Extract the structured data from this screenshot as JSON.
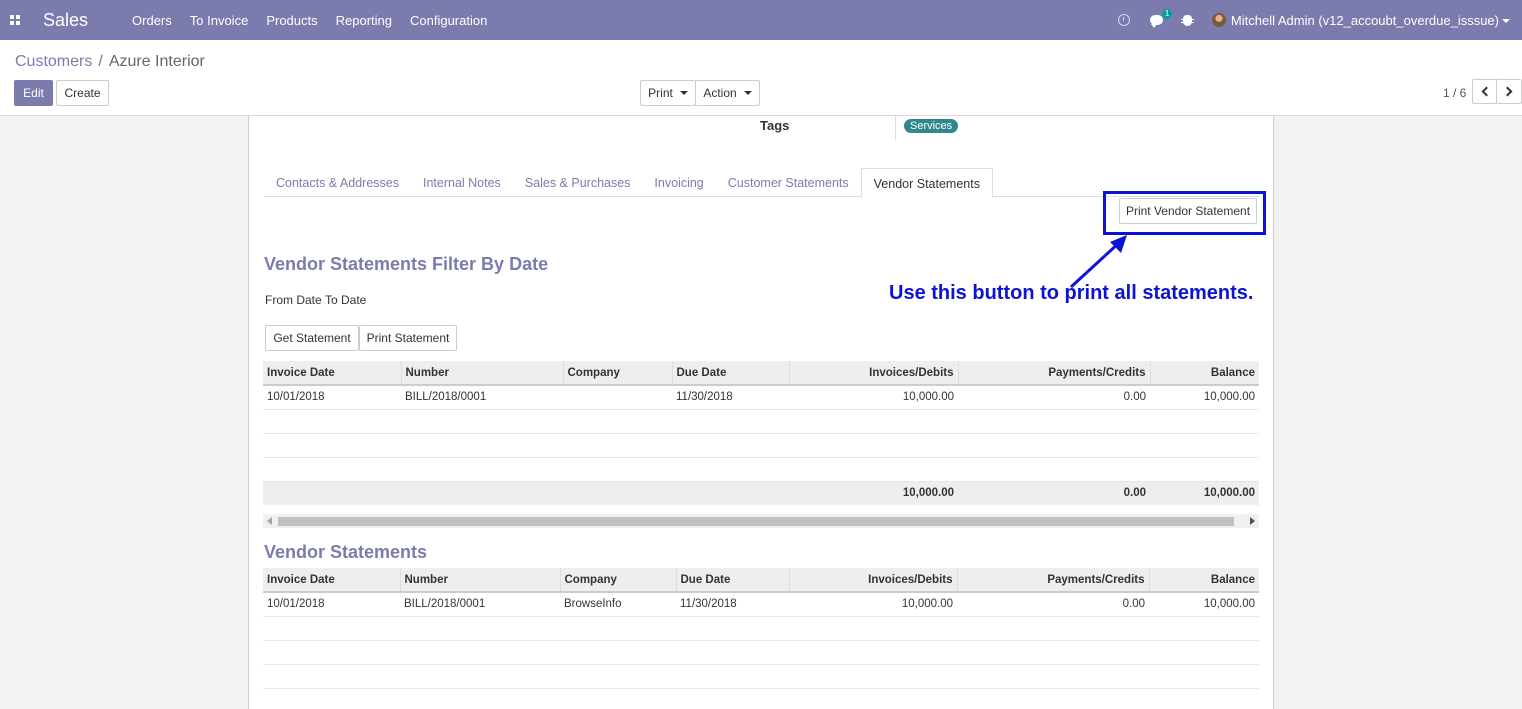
{
  "navbar": {
    "brand": "Sales",
    "menu": [
      "Orders",
      "To Invoice",
      "Products",
      "Reporting",
      "Configuration"
    ],
    "chat_badge": "1",
    "user": "Mitchell Admin (v12_accoubt_overdue_isssue)"
  },
  "breadcrumb": {
    "parent": "Customers",
    "separator": "/",
    "current": "Azure Interior"
  },
  "buttons": {
    "edit": "Edit",
    "create": "Create",
    "print": "Print",
    "action": "Action"
  },
  "pager": {
    "value": "1 / 6"
  },
  "form": {
    "tags_label": "Tags",
    "tag": "Services",
    "tabs": [
      "Contacts & Addresses",
      "Internal Notes",
      "Sales & Purchases",
      "Invoicing",
      "Customer Statements",
      "Vendor Statements"
    ],
    "print_vendor_statement": "Print Vendor Statement",
    "annotation": "Use this button to print all statements.",
    "filter_title": "Vendor Statements Filter By Date",
    "from_date": "From Date",
    "to_date": "To Date",
    "get_statement": "Get Statement",
    "print_statement": "Print Statement",
    "statements_title": "Vendor Statements"
  },
  "filter_table": {
    "columns": [
      "Invoice Date",
      "Number",
      "Company",
      "Due Date",
      "Invoices/Debits",
      "Payments/Credits",
      "Balance"
    ],
    "rows": [
      [
        "10/01/2018",
        "BILL/2018/0001",
        "",
        "11/30/2018",
        "10,000.00",
        "0.00",
        "10,000.00"
      ]
    ],
    "totals": [
      "",
      "",
      "",
      "",
      "10,000.00",
      "0.00",
      "10,000.00"
    ]
  },
  "statements_table": {
    "columns": [
      "Invoice Date",
      "Number",
      "Company",
      "Due Date",
      "Invoices/Debits",
      "Payments/Credits",
      "Balance"
    ],
    "rows": [
      [
        "10/01/2018",
        "BILL/2018/0001",
        "BrowseInfo",
        "11/30/2018",
        "10,000.00",
        "0.00",
        "10,000.00"
      ]
    ]
  },
  "colors": {
    "brand": "#7c7bad",
    "annotation": "#0b13d6",
    "tag": "#30888f"
  }
}
